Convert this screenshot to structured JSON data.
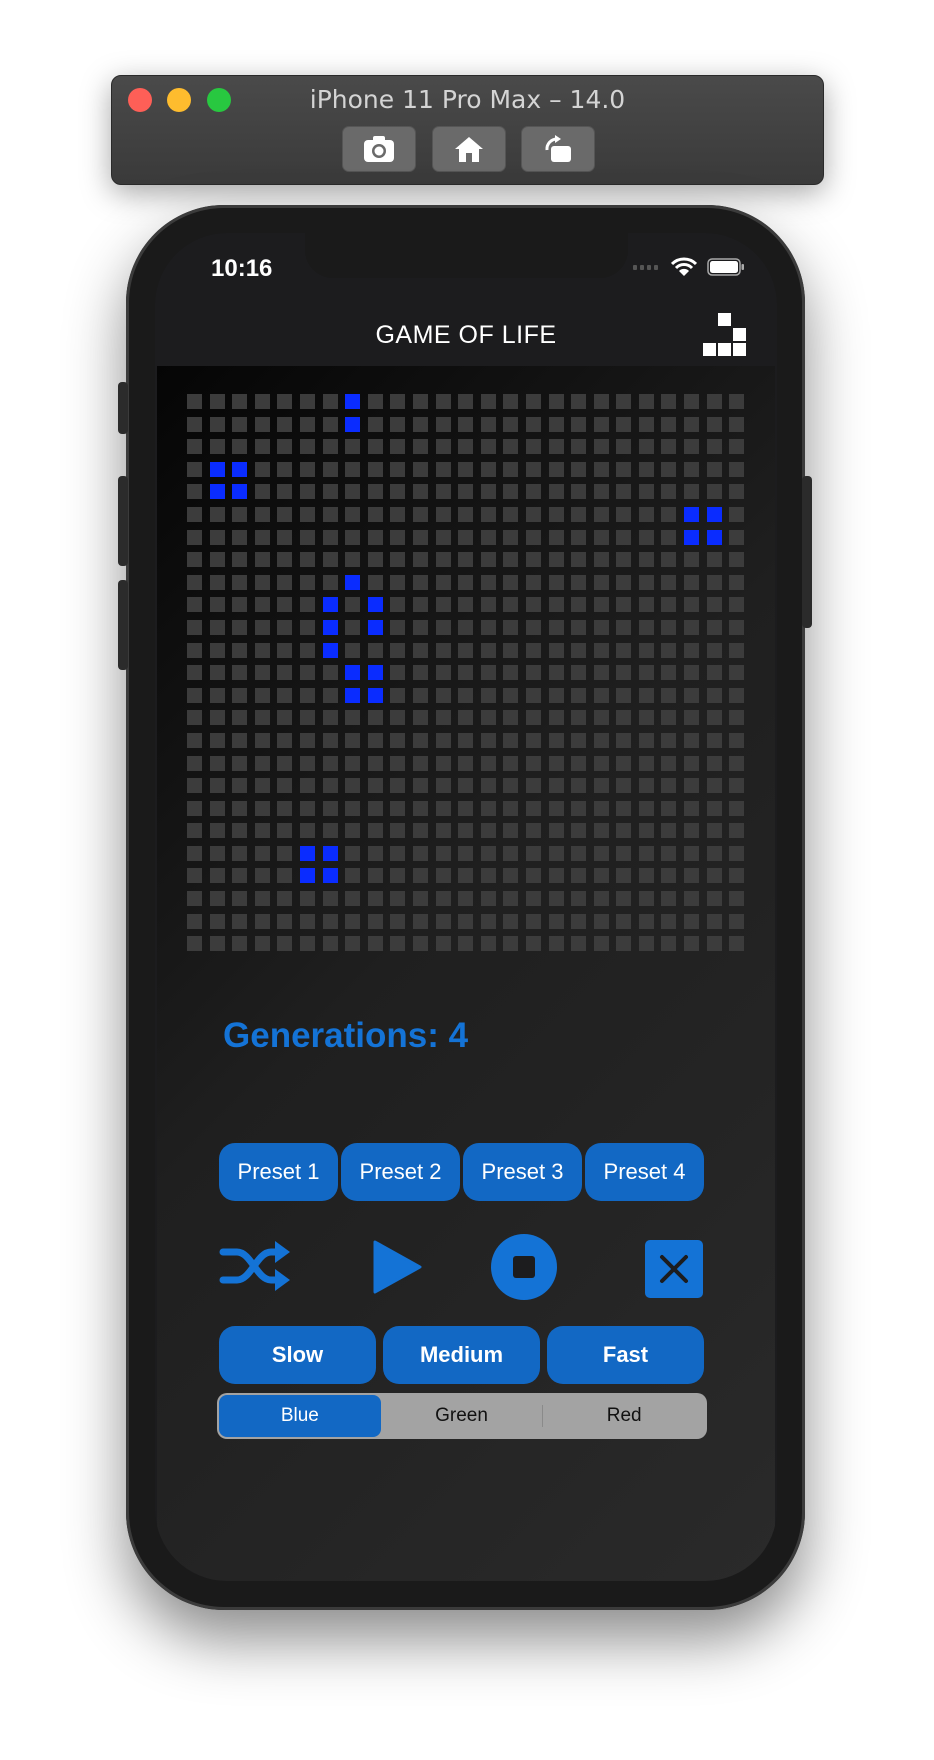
{
  "simulator": {
    "title": "iPhone 11 Pro Max – 14.0",
    "buttons": [
      "screenshot-icon",
      "home-icon",
      "rotate-icon"
    ]
  },
  "status_bar": {
    "time": "10:16"
  },
  "nav": {
    "title": "GAME OF LIFE",
    "icon": "grid-blocks-icon"
  },
  "board": {
    "columns": 25,
    "rows": 25,
    "alive_color": "#0a2cff",
    "dead_color": "#3c3c3c",
    "alive_cells": [
      [
        0,
        7
      ],
      [
        1,
        7
      ],
      [
        3,
        1
      ],
      [
        3,
        2
      ],
      [
        4,
        1
      ],
      [
        4,
        2
      ],
      [
        5,
        22
      ],
      [
        5,
        23
      ],
      [
        6,
        22
      ],
      [
        6,
        23
      ],
      [
        8,
        7
      ],
      [
        9,
        6
      ],
      [
        9,
        8
      ],
      [
        10,
        6
      ],
      [
        10,
        8
      ],
      [
        11,
        6
      ],
      [
        12,
        7
      ],
      [
        12,
        8
      ],
      [
        13,
        7
      ],
      [
        13,
        8
      ],
      [
        20,
        5
      ],
      [
        20,
        6
      ],
      [
        21,
        5
      ],
      [
        21,
        6
      ]
    ]
  },
  "generations": {
    "label": "Generations: 4"
  },
  "presets": [
    "Preset 1",
    "Preset 2",
    "Preset 3",
    "Preset 4"
  ],
  "controls": [
    "shuffle-icon",
    "play-icon",
    "stop-icon",
    "clear-icon"
  ],
  "speeds": [
    "Slow",
    "Medium",
    "Fast"
  ],
  "color_picker": {
    "options": [
      "Blue",
      "Green",
      "Red"
    ],
    "selected": "Blue",
    "accent": "#1268c4"
  }
}
